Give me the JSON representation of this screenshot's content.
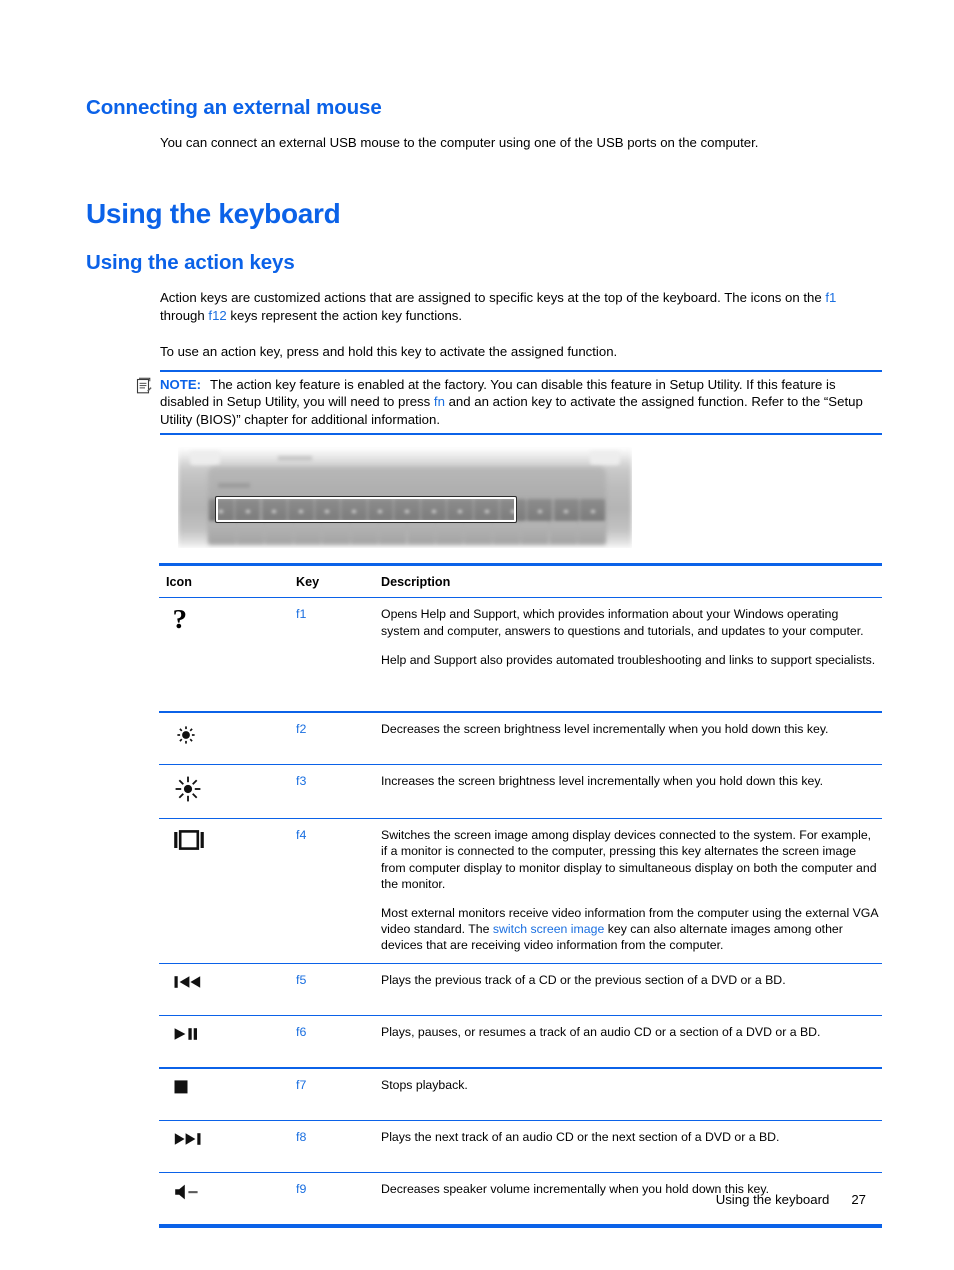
{
  "sections": {
    "mouse_heading": "Connecting an external mouse",
    "mouse_para": "You can connect an external USB mouse to the computer using one of the USB ports on the computer.",
    "keyboard_heading": "Using the keyboard",
    "action_keys_heading": "Using the action keys",
    "action_para_1_a": "Action keys are customized actions that are assigned to specific keys at the top of the keyboard. The icons on the ",
    "action_para_1_f1": "f1",
    "action_para_1_b": " through ",
    "action_para_1_f12": "f12",
    "action_para_1_c": " keys represent the action key functions.",
    "action_para_2": "To use an action key, press and hold this key to activate the assigned function."
  },
  "note": {
    "label": "NOTE:",
    "text_a": "The action key feature is enabled at the factory. You can disable this feature in Setup Utility. If this feature is disabled in Setup Utility, you will need to press ",
    "link_fn": "fn",
    "text_b": " and an action key to activate the assigned function. Refer to the “Setup Utility (BIOS)” chapter for additional information."
  },
  "figure": {
    "alt": "Blurred grayscale photo of a laptop keyboard with the function key row highlighted by a white rectangle"
  },
  "table": {
    "headers": {
      "icon": "Icon",
      "key": "Key",
      "description": "Description"
    },
    "rows": [
      {
        "icon_name": "help-question-mark-icon",
        "key": "f1",
        "paragraphs": [
          "Opens Help and Support, which provides information about your Windows operating system and computer, answers to questions and tutorials, and updates to your computer.",
          "Help and Support also provides automated troubleshooting and links to support specialists."
        ]
      },
      {
        "icon_name": "brightness-decrease-icon",
        "key": "f2",
        "paragraphs": [
          "Decreases the screen brightness level incrementally when you hold down this key."
        ]
      },
      {
        "icon_name": "brightness-increase-icon",
        "key": "f3",
        "paragraphs": [
          "Increases the screen brightness level incrementally when you hold down this key."
        ]
      },
      {
        "icon_name": "switch-screen-image-icon",
        "key": "f4",
        "paragraphs": [
          "Switches the screen image among display devices connected to the system. For example, if a monitor is connected to the computer, pressing this key alternates the screen image from computer display to monitor display to simultaneous display on both the computer and the monitor."
        ],
        "paragraph_2_a": "Most external monitors receive video information from the computer using the external VGA video standard. The ",
        "paragraph_2_link": "switch screen image",
        "paragraph_2_b": " key can also alternate images among other devices that are receiving video information from the computer."
      },
      {
        "icon_name": "previous-track-icon",
        "key": "f5",
        "paragraphs": [
          "Plays the previous track of a CD or the previous section of a DVD or a BD."
        ]
      },
      {
        "icon_name": "play-pause-icon",
        "key": "f6",
        "paragraphs": [
          "Plays, pauses, or resumes a track of an audio CD or a section of a DVD or a BD."
        ]
      },
      {
        "icon_name": "stop-icon",
        "key": "f7",
        "paragraphs": [
          "Stops playback."
        ]
      },
      {
        "icon_name": "next-track-icon",
        "key": "f8",
        "paragraphs": [
          "Plays the next track of an audio CD or the next section of a DVD or a BD."
        ]
      },
      {
        "icon_name": "volume-down-icon",
        "key": "f9",
        "paragraphs": [
          "Decreases speaker volume incrementally when you hold down this key."
        ]
      }
    ]
  },
  "footer": {
    "chapter": "Using the keyboard",
    "page": "27"
  },
  "colors": {
    "heading_blue": "#0b62e8",
    "link_blue": "#1a6fe0",
    "rule_blue": "#0b62e8"
  }
}
